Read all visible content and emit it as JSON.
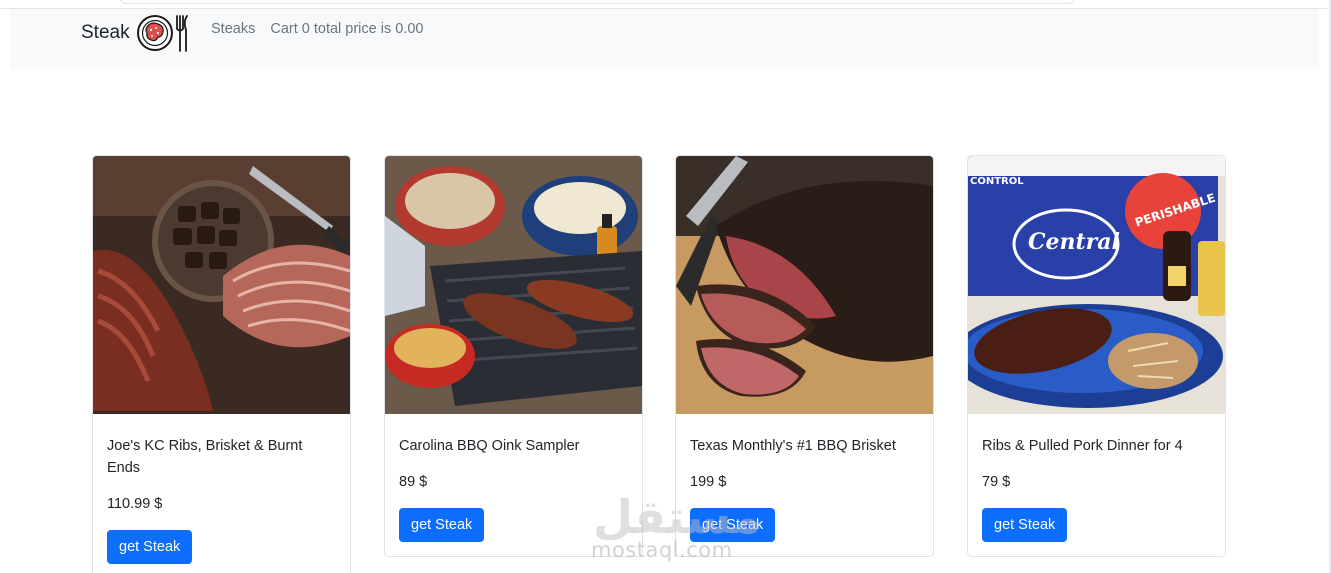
{
  "navbar": {
    "brand_label": "Steak",
    "links": [
      {
        "label": "Steaks"
      },
      {
        "label": "Cart 0 total price is 0.00"
      }
    ]
  },
  "products": [
    {
      "title": "Joe's KC Ribs, Brisket & Burnt Ends",
      "price": "110.99 $",
      "button_label": "get Steak"
    },
    {
      "title": "Carolina BBQ Oink Sampler",
      "price": "89 $",
      "button_label": "get Steak"
    },
    {
      "title": "Texas Monthly's #1 BBQ Brisket",
      "price": "199 $",
      "button_label": "get Steak"
    },
    {
      "title": "Ribs & Pulled Pork Dinner for 4",
      "price": "79 $",
      "button_label": "get Steak"
    }
  ],
  "watermark": {
    "word": "مستقل",
    "site": "mostaql.com"
  },
  "colors": {
    "navbar_bg": "#f8f9fa",
    "button_bg": "#0d6efd",
    "nav_link": "#6c757d",
    "logo_red": "#e0504b"
  }
}
